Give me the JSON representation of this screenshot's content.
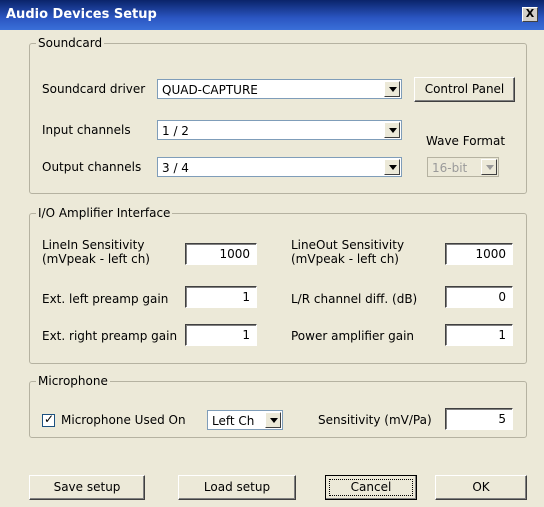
{
  "window": {
    "title": "Audio Devices Setup",
    "close_label": "X"
  },
  "soundcard": {
    "legend": "Soundcard",
    "driver_label": "Soundcard driver",
    "driver_value": "QUAD-CAPTURE",
    "control_panel_label": "Control Panel",
    "input_label": "Input channels",
    "input_value": "1 / 2",
    "output_label": "Output channels",
    "output_value": "3 / 4",
    "wave_format_label": "Wave Format",
    "wave_format_value": "16-bit"
  },
  "io": {
    "legend": "I/O Amplifier Interface",
    "linein_label_1": "LineIn Sensitivity",
    "linein_label_2": "(mVpeak - left ch)",
    "linein_value": "1000",
    "lineout_label_1": "LineOut Sensitivity",
    "lineout_label_2": "(mVpeak - left ch)",
    "lineout_value": "1000",
    "left_preamp_label": "Ext. left preamp gain",
    "left_preamp_value": "1",
    "lr_diff_label": "L/R channel diff. (dB)",
    "lr_diff_value": "0",
    "right_preamp_label": "Ext. right preamp gain",
    "right_preamp_value": "1",
    "power_amp_label": "Power amplifier gain",
    "power_amp_value": "1"
  },
  "microphone": {
    "legend": "Microphone",
    "used_label": "Microphone Used On",
    "used_checked": true,
    "channel_value": "Left Ch",
    "sensitivity_label": "Sensitivity (mV/Pa)",
    "sensitivity_value": "5"
  },
  "buttons": {
    "save": "Save setup",
    "load": "Load setup",
    "cancel": "Cancel",
    "ok": "OK"
  }
}
